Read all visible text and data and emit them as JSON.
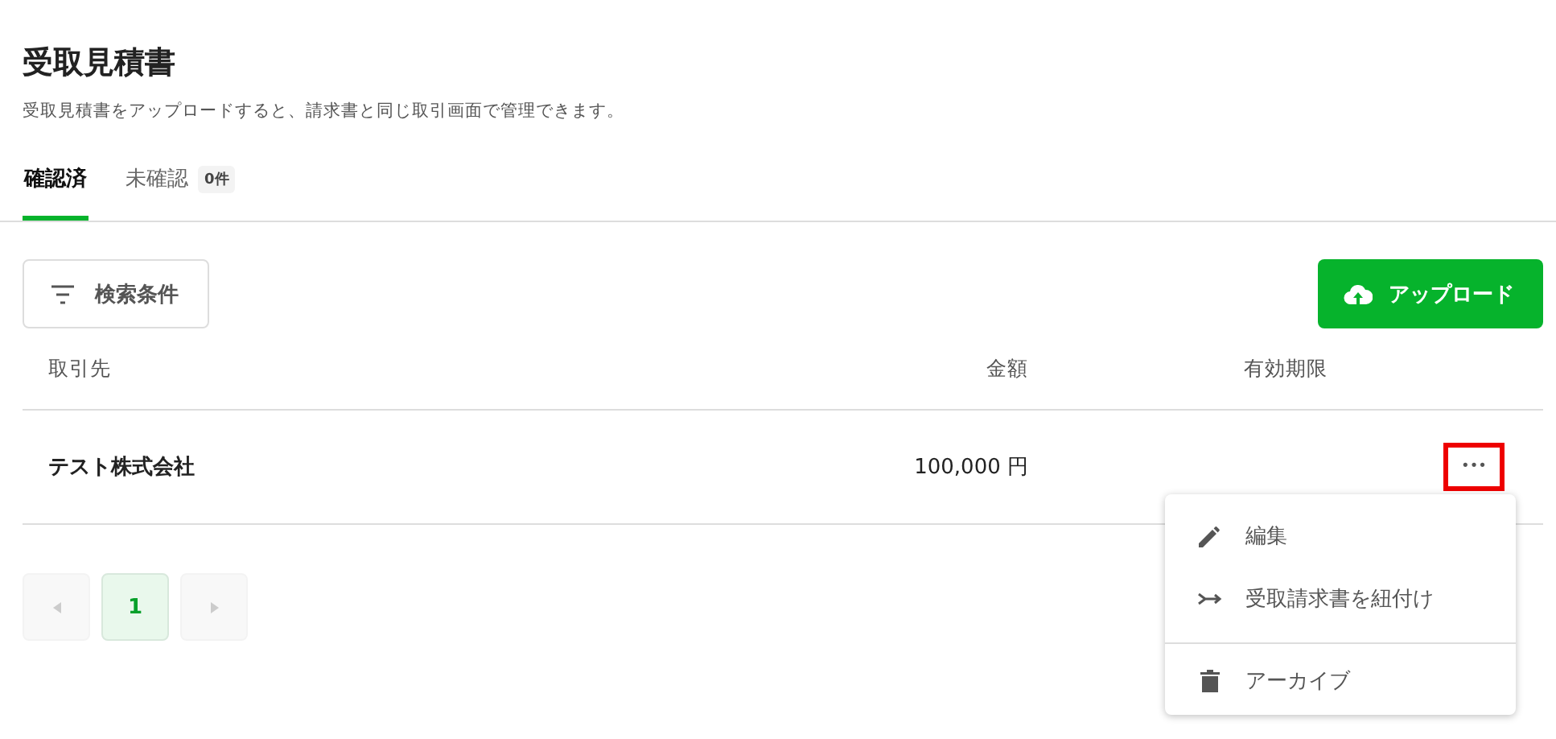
{
  "page": {
    "title": "受取見積書",
    "description": "受取見積書をアップロードすると、請求書と同じ取引画面で管理できます。"
  },
  "tabs": [
    {
      "label": "確認済",
      "selected": true
    },
    {
      "label": "未確認",
      "badge": "0件",
      "selected": false
    }
  ],
  "toolbar": {
    "filter_button": "検索条件",
    "upload_button": "アップロード"
  },
  "table": {
    "columns": [
      "取引先",
      "金額",
      "有効期限"
    ],
    "rows": [
      {
        "partner": "テスト株式会社",
        "amount": "100,000 円",
        "more_button": "•••",
        "highlighted": true
      }
    ]
  },
  "menu": {
    "items": [
      {
        "kind": "edit",
        "label": "編集"
      },
      {
        "kind": "link",
        "label": "受取請求書を紐付け"
      },
      {
        "kind": "archive",
        "label": "アーカイブ",
        "divider_before": true
      }
    ]
  },
  "pagination": {
    "pages": [
      {
        "label": "1",
        "selected": true
      }
    ]
  }
}
